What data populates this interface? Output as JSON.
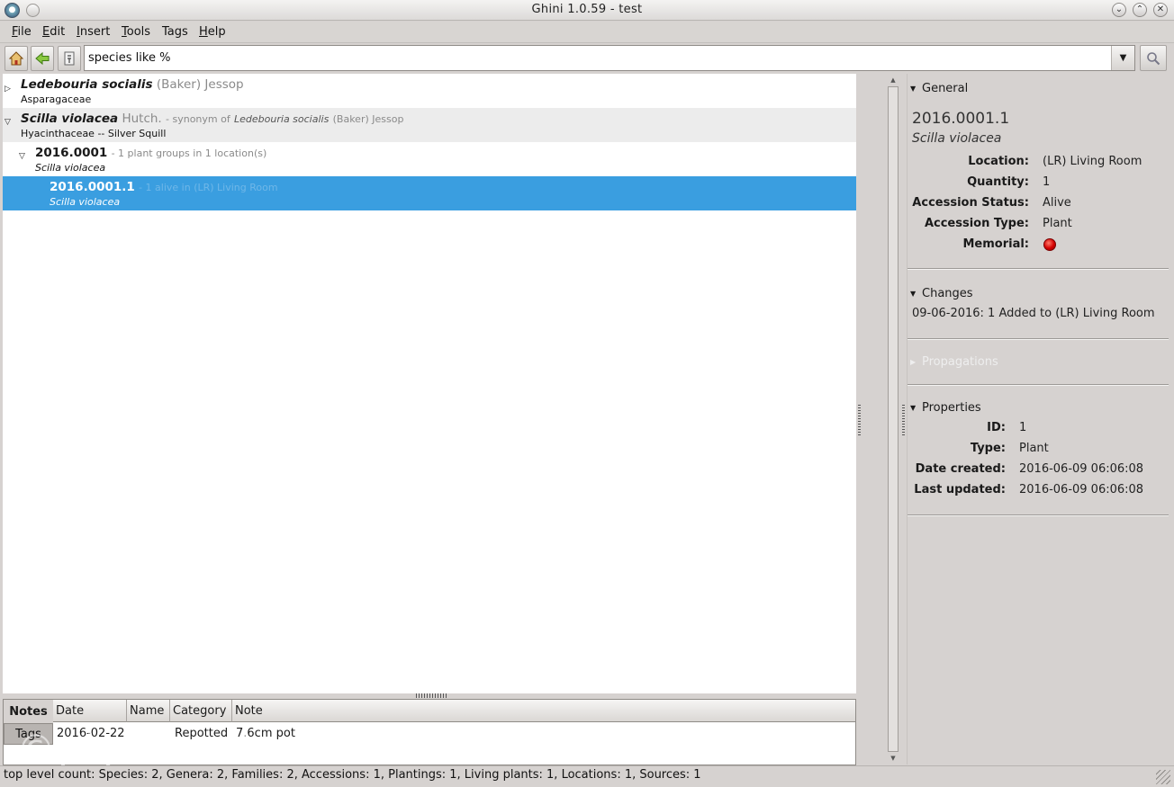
{
  "window": {
    "title": "Ghini 1.0.59 - test",
    "controls": {
      "minimize": "⌄",
      "maximize": "⌃",
      "close": "✕"
    }
  },
  "menu": {
    "file": {
      "u": "F",
      "rest": "ile"
    },
    "edit": {
      "u": "E",
      "rest": "dit"
    },
    "insert": {
      "u": "I",
      "rest": "nsert"
    },
    "tools": {
      "u": "T",
      "rest": "ools"
    },
    "tags": {
      "label": "Tags"
    },
    "help": {
      "u": "H",
      "rest": "elp"
    }
  },
  "toolbar": {
    "home_icon": "home-icon",
    "back_icon": "back-arrow-icon",
    "prefs_icon": "preferences-icon",
    "search_value": "species like %",
    "search_go_icon": "magnifier-icon"
  },
  "results": {
    "species1": {
      "name": "Ledebouria socialis",
      "author": "(Baker) Jessop",
      "family": "Asparagaceae"
    },
    "species2": {
      "name": "Scilla violacea",
      "author": "Hutch.",
      "syn_prefix": "- synonym of",
      "syn_name": "Ledebouria socialis",
      "syn_author": "(Baker) Jessop",
      "family": "Hyacinthaceae -- Silver Squill"
    },
    "accession": {
      "code": "2016.0001",
      "summary": "- 1 plant groups in 1 location(s)",
      "species": "Scilla violacea"
    },
    "plant": {
      "code": "2016.0001.1",
      "summary": "- 1 alive in (LR) Living Room",
      "species": "Scilla violacea"
    }
  },
  "notes": {
    "tabs": {
      "notes": "Notes",
      "tags": "Tags"
    },
    "columns": {
      "date": "Date",
      "name": "Name",
      "category": "Category",
      "note": "Note"
    },
    "row": {
      "date": "2016-02-22",
      "name": "",
      "category": "Repotted",
      "note": "7.6cm pot"
    }
  },
  "info": {
    "general": {
      "title": "General",
      "id": "2016.0001.1",
      "species": "Scilla violacea",
      "location_label": "Location:",
      "location": "(LR) Living Room",
      "quantity_label": "Quantity:",
      "quantity": "1",
      "status_label": "Accession Status:",
      "status": "Alive",
      "type_label": "Accession Type:",
      "type": "Plant",
      "memorial_label": "Memorial:",
      "memorial_color": "#d40000"
    },
    "changes": {
      "title": "Changes",
      "entry": "09-06-2016: 1 Added to (LR) Living Room"
    },
    "propagations": {
      "title": "Propagations"
    },
    "properties": {
      "title": "Properties",
      "id_label": "ID:",
      "id": "1",
      "type_label": "Type:",
      "type": "Plant",
      "created_label": "Date created:",
      "created": "2016-06-09 06:06:08",
      "updated_label": "Last updated:",
      "updated": "2016-06-09 06:06:08"
    }
  },
  "status": {
    "text": "top level count: Species: 2, Genera: 2, Families: 2, Accessions: 1, Plantings: 1, Living plants: 1, Locations: 1, Sources: 1"
  },
  "watermark": "©ply.me.uk",
  "colors": {
    "selection": "#3a9ee0",
    "panel": "#d6d2d0"
  }
}
